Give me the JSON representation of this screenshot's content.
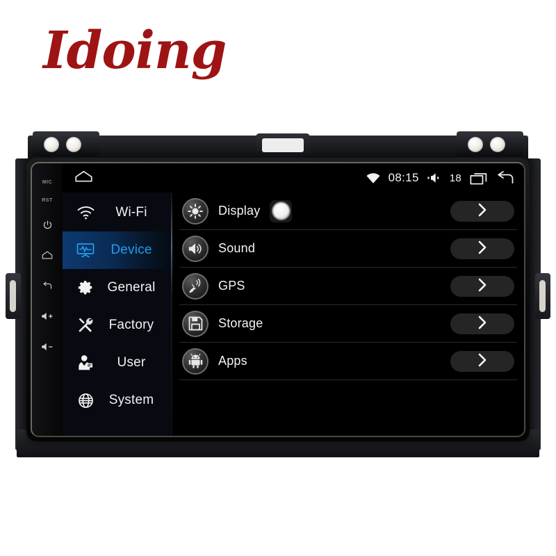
{
  "brand": {
    "logo_text": "Idoing",
    "logo_color": "#9e1414"
  },
  "hardware": {
    "labels": [
      {
        "name": "mic-label",
        "text": "MIC"
      },
      {
        "name": "reset-label",
        "text": "RST"
      }
    ],
    "keys": [
      {
        "name": "power-key",
        "icon": "power-icon"
      },
      {
        "name": "home-key",
        "icon": "home-icon"
      },
      {
        "name": "back-key",
        "icon": "back-icon"
      },
      {
        "name": "volume-up-key",
        "icon": "volume-up-icon"
      },
      {
        "name": "volume-down-key",
        "icon": "volume-down-icon"
      }
    ]
  },
  "status_bar": {
    "home_icon": "home-icon",
    "wifi_icon": "wifi-icon",
    "time": "08:15",
    "volume_icon": "volume-icon",
    "volume_level": "18",
    "recents_icon": "recents-icon",
    "back_icon": "back-icon"
  },
  "sidebar": {
    "selected": "Device",
    "accent_color": "#1f9ff0",
    "items": [
      {
        "label": "Wi-Fi",
        "icon": "wifi-icon",
        "selected": false
      },
      {
        "label": "Device",
        "icon": "monitor-pulse-icon",
        "selected": true
      },
      {
        "label": "General",
        "icon": "gear-icon",
        "selected": false
      },
      {
        "label": "Factory",
        "icon": "tools-icon",
        "selected": false
      },
      {
        "label": "User",
        "icon": "user-icon",
        "selected": false
      },
      {
        "label": "System",
        "icon": "globe-icon",
        "selected": false
      }
    ]
  },
  "settings_list": {
    "chevron_icon": "chevron-right-icon",
    "rows": [
      {
        "label": "Display",
        "icon": "brightness-icon",
        "has_touch_indicator": true
      },
      {
        "label": "Sound",
        "icon": "speaker-icon",
        "has_touch_indicator": false
      },
      {
        "label": "GPS",
        "icon": "satellite-icon",
        "has_touch_indicator": false
      },
      {
        "label": "Storage",
        "icon": "floppy-disk-icon",
        "has_touch_indicator": false
      },
      {
        "label": "Apps",
        "icon": "android-icon",
        "has_touch_indicator": false
      }
    ]
  }
}
